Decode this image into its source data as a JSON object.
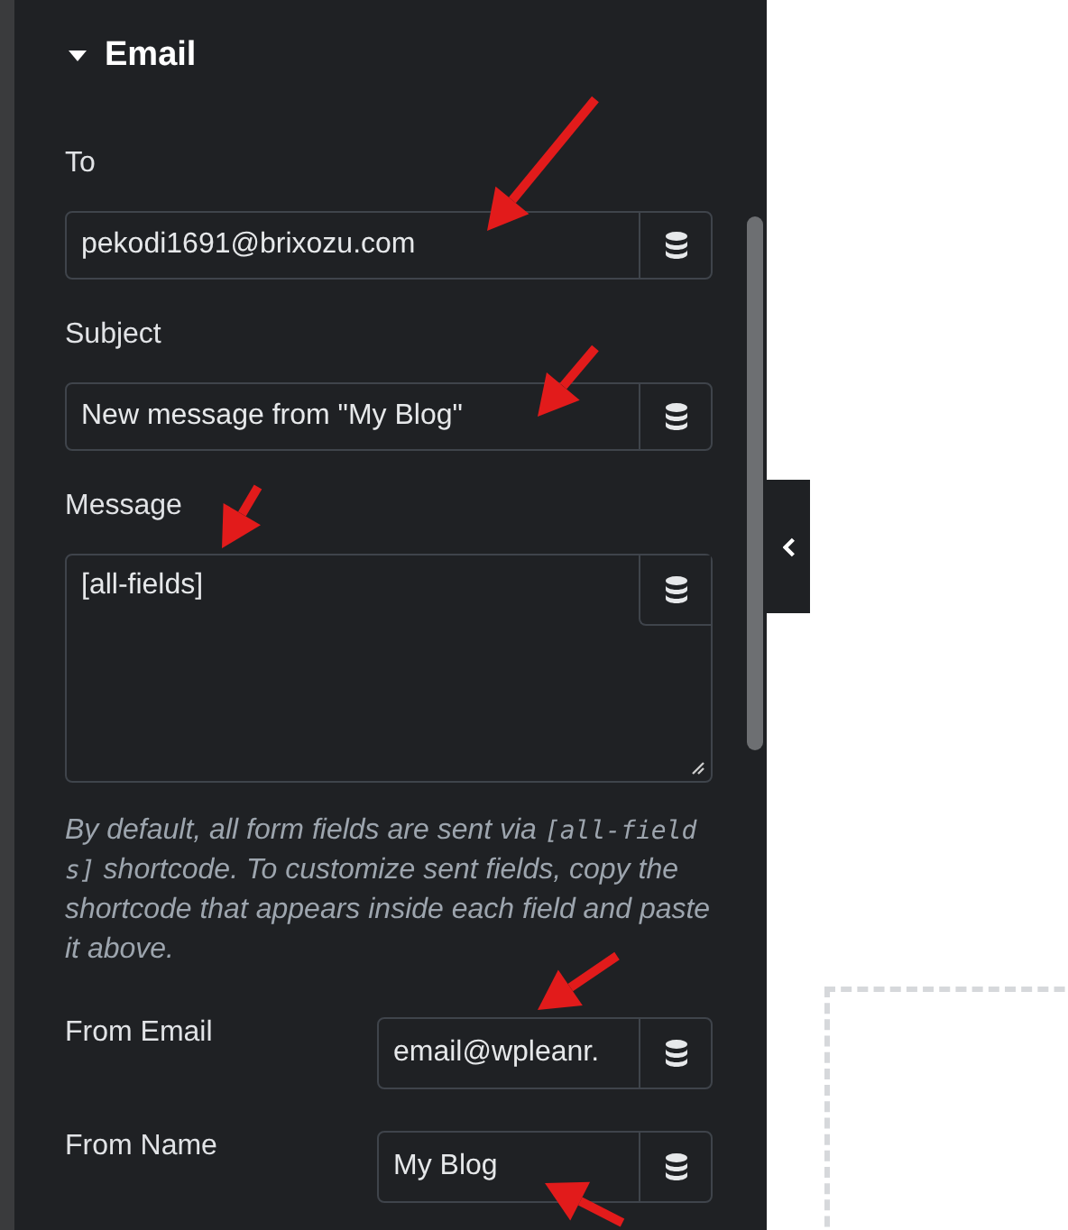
{
  "section": {
    "title": "Email",
    "expanded": true
  },
  "fields": [
    {
      "kind": "stacked",
      "label": "To",
      "value": "pekodi1691@brixozu.com"
    },
    {
      "kind": "stacked",
      "label": "Subject",
      "value": "New message from \"My Blog\""
    },
    {
      "kind": "textarea",
      "label": "Message",
      "value": "[all-fields]"
    }
  ],
  "help": [
    {
      "kind": "text",
      "text": "By default, all form fields are sent via "
    },
    {
      "kind": "code",
      "text": "[all-fields]"
    },
    {
      "kind": "text",
      "text": " shortcode. To customize sent fields, copy the shortcode that appears inside each field and paste it above."
    }
  ],
  "inline_fields": [
    {
      "label": "From Email",
      "value": "email@wpleanr."
    },
    {
      "label": "From Name",
      "value": "My Blog"
    }
  ]
}
